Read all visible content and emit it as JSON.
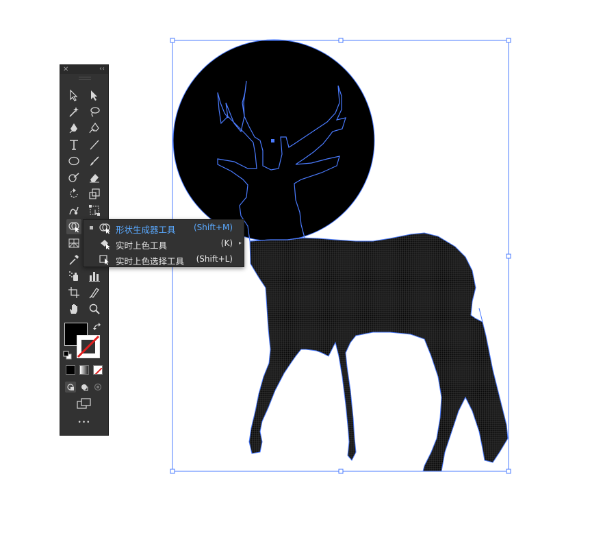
{
  "flyout": {
    "items": [
      {
        "label": "形状生成器工具",
        "shortcut": "(Shift+M)",
        "selected": true,
        "has_submenu": false
      },
      {
        "label": "实时上色工具",
        "shortcut": "(K)",
        "selected": false,
        "has_submenu": true
      },
      {
        "label": "实时上色选择工具",
        "shortcut": "(Shift+L)",
        "selected": false,
        "has_submenu": false
      }
    ],
    "submenu_glyph": "▸"
  },
  "toolbar": {
    "close_glyph": "✕",
    "collapse_glyph": "‹‹",
    "more_glyph": "•••",
    "tools": [
      "selection-tool",
      "direct-selection-tool",
      "magic-wand-tool",
      "lasso-tool",
      "pen-tool",
      "curvature-tool",
      "type-tool",
      "line-segment-tool",
      "ellipse-tool",
      "paintbrush-tool",
      "shaper-tool",
      "eraser-tool",
      "rotate-tool",
      "scale-tool",
      "warp-tool",
      "free-transform-tool",
      "shape-builder-tool",
      "perspective-grid-tool",
      "eyedropper-tool",
      "symbol-sprayer-tool",
      "column-graph-tool",
      "artboard-tool",
      "slice-tool",
      "hand-tool",
      "zoom-tool"
    ],
    "fill_color": "#000000",
    "stroke_color": "none"
  },
  "colors": {
    "panel": "#323232",
    "selection": "#4a7bff",
    "highlight_text": "#5aa9ff"
  }
}
